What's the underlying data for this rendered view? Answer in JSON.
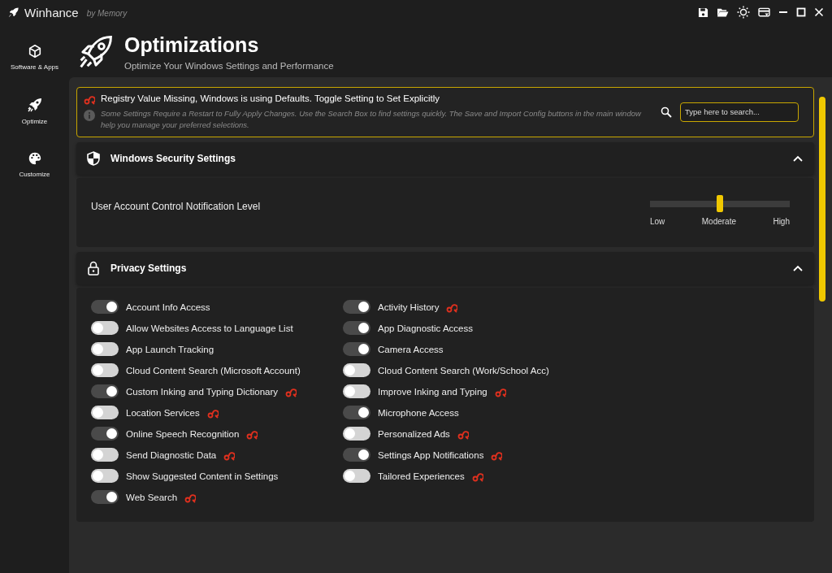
{
  "window": {
    "title": "Winhance",
    "subtitle": "by Memory"
  },
  "sidebar": {
    "items": [
      {
        "label": "Software & Apps"
      },
      {
        "label": "Optimize"
      },
      {
        "label": "Customize"
      }
    ]
  },
  "header": {
    "title": "Optimizations",
    "subtitle": "Optimize Your Windows Settings and Performance"
  },
  "banner": {
    "warning": "Registry Value Missing, Windows is using Defaults. Toggle Setting to Set Explicitly",
    "info": "Some Settings Require a Restart to Fully Apply Changes. Use the Search Box to find settings quickly. The Save and Import Config buttons in the main window help you manage your preferred selections.",
    "search": {
      "placeholder": "Type here to search..."
    }
  },
  "sections": [
    {
      "title": "Windows Security Settings",
      "expanded": true,
      "kind": "slider",
      "setting": {
        "label": "User Account Control Notification Level",
        "level": 0.5,
        "ticks": [
          "Low",
          "Moderate",
          "High"
        ]
      }
    },
    {
      "title": "Privacy Settings",
      "expanded": true,
      "kind": "toggles",
      "columns": [
        [
          {
            "label": "Account Info Access",
            "on": true,
            "registry_missing": false
          },
          {
            "label": "Allow Websites Access to Language List",
            "on": false,
            "registry_missing": false
          },
          {
            "label": "App Launch Tracking",
            "on": false,
            "registry_missing": false
          },
          {
            "label": "Cloud Content Search (Microsoft Account)",
            "on": false,
            "registry_missing": false
          },
          {
            "label": "Custom Inking and Typing Dictionary",
            "on": true,
            "registry_missing": true
          },
          {
            "label": "Location Services",
            "on": false,
            "registry_missing": true
          },
          {
            "label": "Online Speech Recognition",
            "on": true,
            "registry_missing": true
          },
          {
            "label": "Send Diagnostic Data",
            "on": false,
            "registry_missing": true
          },
          {
            "label": "Show Suggested Content in Settings",
            "on": false,
            "registry_missing": false
          },
          {
            "label": "Web Search",
            "on": true,
            "registry_missing": true
          }
        ],
        [
          {
            "label": "Activity History",
            "on": true,
            "registry_missing": true
          },
          {
            "label": "App Diagnostic Access",
            "on": true,
            "registry_missing": false
          },
          {
            "label": "Camera Access",
            "on": true,
            "registry_missing": false
          },
          {
            "label": "Cloud Content Search (Work/School Acc)",
            "on": false,
            "registry_missing": false
          },
          {
            "label": "Improve Inking and Typing",
            "on": false,
            "registry_missing": true
          },
          {
            "label": "Microphone Access",
            "on": true,
            "registry_missing": false
          },
          {
            "label": "Personalized Ads",
            "on": false,
            "registry_missing": true
          },
          {
            "label": "Settings App Notifications",
            "on": true,
            "registry_missing": true
          },
          {
            "label": "Tailored Experiences",
            "on": false,
            "registry_missing": true
          }
        ]
      ]
    }
  ]
}
